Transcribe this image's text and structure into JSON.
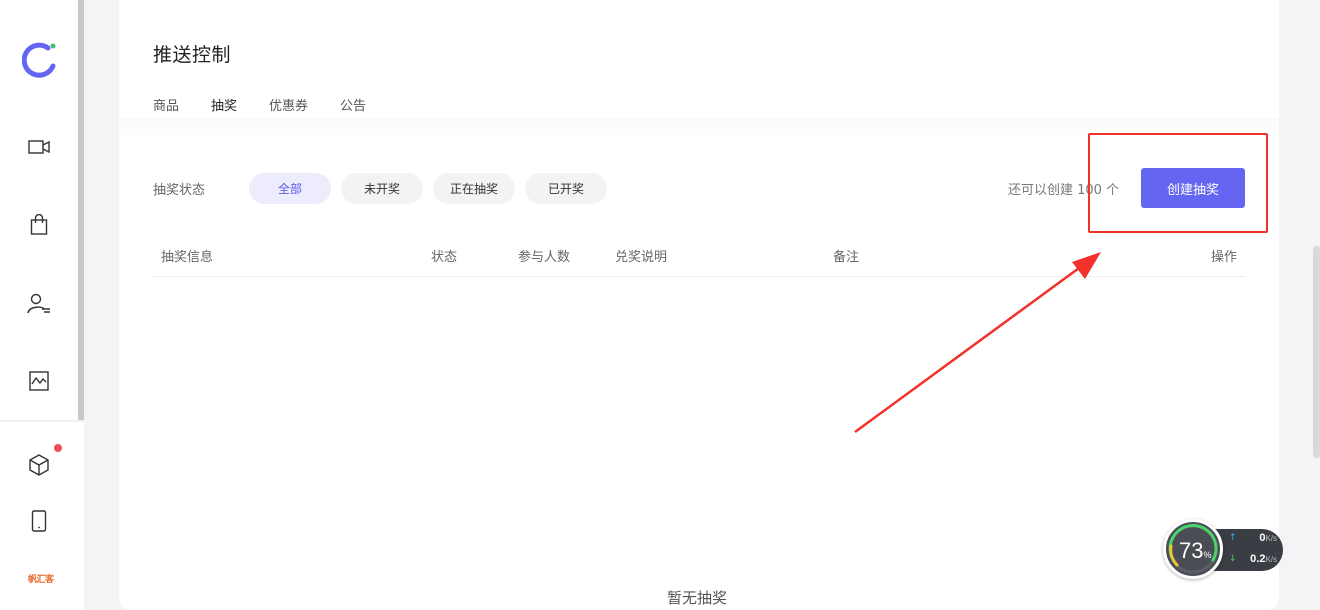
{
  "sidebar": {
    "icons": [
      "video-camera-icon",
      "shopping-bag-icon",
      "user-list-icon",
      "chart-frame-icon",
      "cube-icon",
      "mobile-phone-icon"
    ],
    "brand_mark": "帆汇客"
  },
  "header": {
    "title": "推送控制",
    "tabs": [
      {
        "label": "商品"
      },
      {
        "label": "抽奖"
      },
      {
        "label": "优惠券"
      },
      {
        "label": "公告"
      }
    ]
  },
  "filter": {
    "label": "抽奖状态",
    "chips": [
      {
        "label": "全部"
      },
      {
        "label": "未开奖"
      },
      {
        "label": "正在抽奖"
      },
      {
        "label": "已开奖"
      }
    ]
  },
  "quota_text": "还可以创建 100 个",
  "create_button_label": "创建抽奖",
  "table": {
    "columns": [
      "抽奖信息",
      "状态",
      "参与人数",
      "兑奖说明",
      "备注",
      "操作"
    ]
  },
  "empty_text": "暂无抽奖",
  "speed_widget": {
    "percent": "73",
    "percent_unit": "%",
    "upload_value": "0",
    "upload_unit": "K/s",
    "download_value": "0.2",
    "download_unit": "K/s"
  },
  "colors": {
    "accent": "#6466f1",
    "annotation": "#f3312a",
    "chip_active_bg": "#ececfd",
    "chip_active_text": "#5b5be6"
  }
}
